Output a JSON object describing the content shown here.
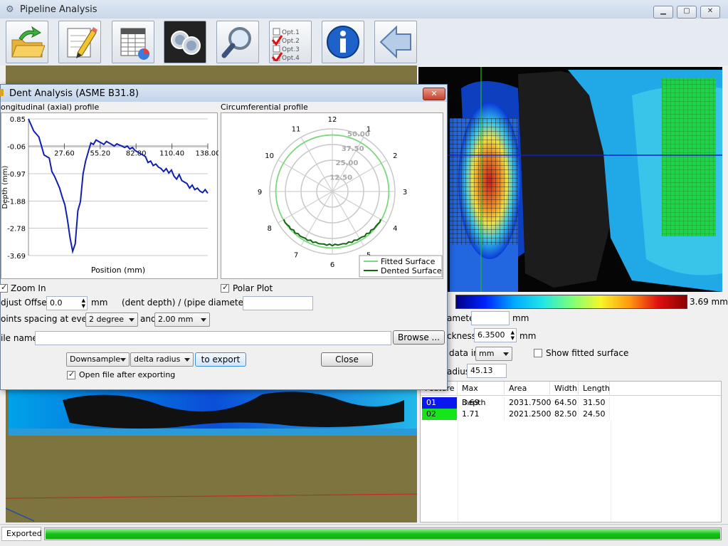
{
  "app": {
    "title": "Pipeline Analysis"
  },
  "toolbar": {
    "icons": [
      "open-folder-icon",
      "pencil-icon",
      "spreadsheet-icon",
      "binoculars-icon",
      "magnifier-icon",
      "options-checklist-icon",
      "info-icon",
      "back-arrow-icon"
    ],
    "options_lines": [
      "Opt.1",
      "Opt.2",
      "Opt.3",
      "Opt.4"
    ]
  },
  "dialog": {
    "title": "Dent Analysis (ASME B31.8)",
    "longitudinal_title": "ongitudinal (axial) profile",
    "circumferential_title": "Circumferential profile",
    "zoom_in_label": "Zoom In",
    "polar_plot_label": "Polar Plot",
    "adjust_offset_label": "djust Offset",
    "adjust_offset_value": "0.0",
    "adjust_offset_unit": "mm",
    "ratio_label": "(dent depth) / (pipe diameter) =",
    "ratio_value": "",
    "points_spacing_label": "oints spacing at every",
    "spacing_degree": "2 degree",
    "and_label": "and",
    "spacing_mm": "2.00 mm",
    "file_name_label": "ile name",
    "file_name_value": "",
    "browse_label": "Browse ...",
    "downsample_label": "Downsample",
    "delta_radius_label": "delta radius",
    "to_export_label": "to export",
    "close_label": "Close",
    "open_after_label": "Open file after exporting"
  },
  "right_panel": {
    "colorbar_max_label": "3.69 mm",
    "diameter_label": "ameter",
    "diameter_value": "",
    "diameter_unit": "mm",
    "thickness_label": "ckness",
    "thickness_value": "6.3500",
    "thickness_unit": "mm",
    "data_in_label": "data in",
    "data_in_value": "mm",
    "show_fitted_label": "Show fitted surface",
    "radius_label": "adius",
    "radius_value": "45.13"
  },
  "table": {
    "headers": [
      "Feature",
      "Max Depth",
      "Area",
      "Width",
      "Length"
    ],
    "rows": [
      {
        "id": "01",
        "color": "#0a18f0",
        "max_depth": "3.69",
        "area": "2031.7500",
        "width": "64.50",
        "length": "31.50"
      },
      {
        "id": "02",
        "color": "#17e51c",
        "max_depth": "1.71",
        "area": "2021.2500",
        "width": "82.50",
        "length": "24.50"
      }
    ]
  },
  "status": {
    "text": "Exported",
    "progress": 1.0
  },
  "colors": {
    "accent": "#0a18f0",
    "fitted": "#7ed67e",
    "dented": "#126612",
    "progress": "#1fd11f"
  },
  "chart_data": [
    {
      "type": "line",
      "title": "ongitudinal (axial) profile",
      "xlabel": "Position (mm)",
      "ylabel": "Depth (mm)",
      "x_ticks": [
        "27.60",
        "55.20",
        "82.80",
        "110.40",
        "138.00"
      ],
      "y_ticks": [
        "0.85",
        "-0.06",
        "-0.97",
        "-1.88",
        "-2.78",
        "-3.69"
      ],
      "xlim": [
        0,
        138
      ],
      "ylim": [
        -3.69,
        0.85
      ],
      "x": [
        0,
        4,
        8,
        12,
        16,
        18,
        20,
        22,
        24,
        26,
        28,
        30,
        32,
        34,
        36,
        38,
        40,
        42,
        44,
        46,
        48,
        50,
        52,
        54,
        56,
        58,
        60,
        62,
        64,
        66,
        68,
        70,
        72,
        74,
        76,
        78,
        80,
        82,
        84,
        86,
        88,
        90,
        92,
        94,
        96,
        98,
        100,
        102,
        104,
        106,
        108,
        110,
        112,
        114,
        116,
        118,
        120,
        122,
        124,
        126,
        128,
        130,
        132,
        134,
        136,
        138
      ],
      "y": [
        0.85,
        0.45,
        0.25,
        -0.35,
        -0.45,
        -0.9,
        -1.05,
        -1.25,
        -1.45,
        -1.75,
        -2.0,
        -2.5,
        -3.1,
        -3.55,
        -3.3,
        -2.2,
        -1.9,
        -0.98,
        -0.55,
        -0.25,
        0.05,
        0.0,
        0.15,
        0.1,
        0.05,
        0.0,
        0.1,
        0.05,
        0.0,
        -0.05,
        0.02,
        -0.02,
        -0.05,
        -0.1,
        -0.05,
        -0.15,
        -0.1,
        -0.2,
        -0.25,
        -0.3,
        -0.35,
        -0.4,
        -0.6,
        -0.55,
        -0.7,
        -0.65,
        -0.75,
        -0.8,
        -0.9,
        -0.8,
        -0.95,
        -0.85,
        -1.05,
        -1.15,
        -1.0,
        -1.2,
        -1.25,
        -1.3,
        -1.45,
        -1.35,
        -1.5,
        -1.45,
        -1.55,
        -1.6,
        -1.5,
        -1.62
      ],
      "series": [
        {
          "name": "",
          "color": "#1020b0"
        }
      ]
    },
    {
      "type": "line",
      "title": "Circumferential profile",
      "polar": true,
      "angle_labels": [
        "12",
        "1",
        "2",
        "3",
        "4",
        "5",
        "6",
        "7",
        "8",
        "9",
        "10",
        "11"
      ],
      "radial_labels": [
        "12.50",
        "25.00",
        "37.50",
        "50.00"
      ],
      "rlim": [
        0,
        50
      ],
      "series": [
        {
          "name": "Fitted Surface",
          "color": "#7ed67e",
          "radius": 45.13,
          "angle_from": 0,
          "angle_to": 360
        },
        {
          "name": "Dented Surface",
          "color": "#126612",
          "radius": 45.13,
          "angle_from": 120,
          "angle_to": 240,
          "dent_depth": 2.5
        }
      ]
    }
  ]
}
